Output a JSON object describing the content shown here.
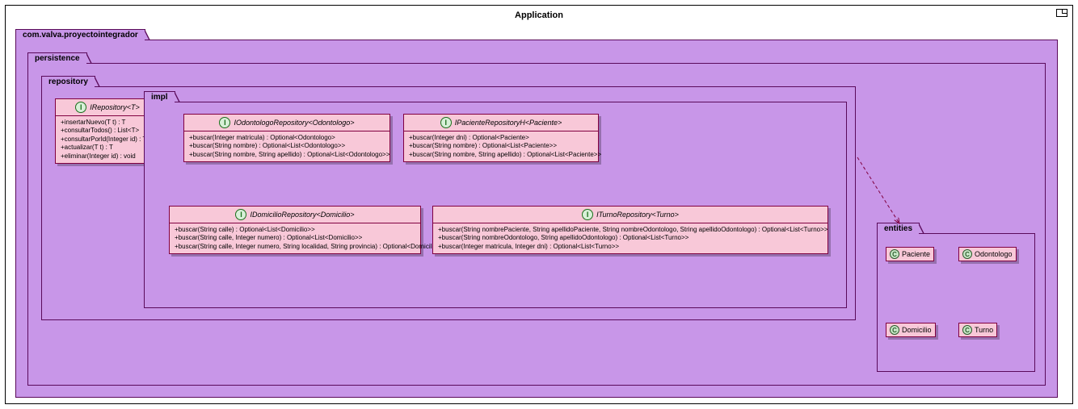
{
  "title": "Application",
  "packages": {
    "root": "com.valva.proyectointegrador",
    "persistence": "persistence",
    "repository": "repository",
    "impl": "impl",
    "entities": "entities"
  },
  "interfaces": {
    "irepo": {
      "name": "IRepository<T>",
      "methods": [
        "+insertarNuevo(T t) : T",
        "+consultarTodos() : List<T>",
        "+consultarPorId(Integer id) : T",
        "+actualizar(T t) : T",
        "+eliminar(Integer id) : void"
      ]
    },
    "iodon": {
      "name": "IOdontologoRepository<Odontologo>",
      "methods": [
        "+buscar(Integer matricula) : Optional<Odontologo>",
        "+buscar(String nombre) : Optional<List<Odontologo>>",
        "+buscar(String nombre, String apellido) : Optional<List<Odontologo>>"
      ]
    },
    "ipac": {
      "name": "IPacienteRepositoryH<Paciente>",
      "methods": [
        "+buscar(Integer dni) : Optional<Paciente>",
        "+buscar(String nombre) : Optional<List<Paciente>>",
        "+buscar(String nombre, String apellido) : Optional<List<Paciente>>"
      ]
    },
    "idom": {
      "name": "IDomicilioRepository<Domicilio>",
      "methods": [
        "+buscar(String calle) : Optional<List<Domicilio>>",
        "+buscar(String calle, Integer numero) : Optional<List<Domicilio>>",
        "+buscar(String calle, Integer numero, String localidad, String provincia) : Optional<Domicilio>"
      ]
    },
    "iturno": {
      "name": "ITurnoRepository<Turno>",
      "methods": [
        "+buscar(String nombrePaciente, String apellidoPaciente, String nombreOdontologo, String apellidoOdontologo) : Optional<List<Turno>>",
        "+buscar(String nombreOdontologo, String apellidoOdontologo) : Optional<List<Turno>>",
        "+buscar(Integer matricula, Integer dni) : Optional<List<Turno>>"
      ]
    }
  },
  "classes": {
    "paciente": "Paciente",
    "odontologo": "Odontologo",
    "domicilio": "Domicilio",
    "turno": "Turno"
  }
}
